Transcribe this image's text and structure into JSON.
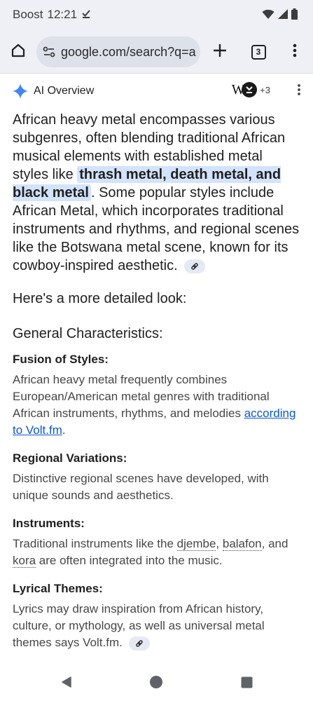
{
  "status_bar": {
    "carrier": "Boost",
    "time": "12:21"
  },
  "toolbar": {
    "url": "google.com/search?q=a",
    "tab_count": "3"
  },
  "ai_overview": {
    "title": "AI Overview",
    "source_count": "+3",
    "source_logo_text": "W",
    "summary": {
      "p1": "African heavy metal encompasses various subgenres, often blending traditional African musical elements with established metal styles like ",
      "highlight": "thrash metal, death metal, and black metal",
      "p2": ". Some popular styles include African Metal, which incorporates traditional instruments and rhythms, and regional scenes like the Botswana metal scene, known for its cowboy-inspired aesthetic."
    },
    "more_look": "Here's a more detailed look:",
    "general_heading": "General Characteristics:",
    "sections": [
      {
        "title": "Fusion of Styles:",
        "body": "African heavy metal frequently combines European/American metal genres with traditional African instruments, rhythms, and melodies ",
        "link": "according to Volt.fm",
        "tail": "."
      },
      {
        "title": "Regional Variations:",
        "body": "Distinctive regional scenes have developed, with unique sounds and aesthetics."
      },
      {
        "title": "Instruments:",
        "before": "Traditional instruments like the ",
        "term1": "djembe",
        "sep1": ", ",
        "term2": "balafon",
        "sep2": ", and ",
        "term3": "kora",
        "after": " are often integrated into the music."
      },
      {
        "title": "Lyrical Themes:",
        "body": "Lyrics may draw inspiration from African history, culture, or mythology, as well as universal metal themes says Volt.fm."
      }
    ]
  },
  "colors": {
    "chrome_bg": "#eef0f6",
    "highlight_bg": "#d3e3fd",
    "link": "#0b57d0",
    "gemini_blue": "#4285f4"
  }
}
